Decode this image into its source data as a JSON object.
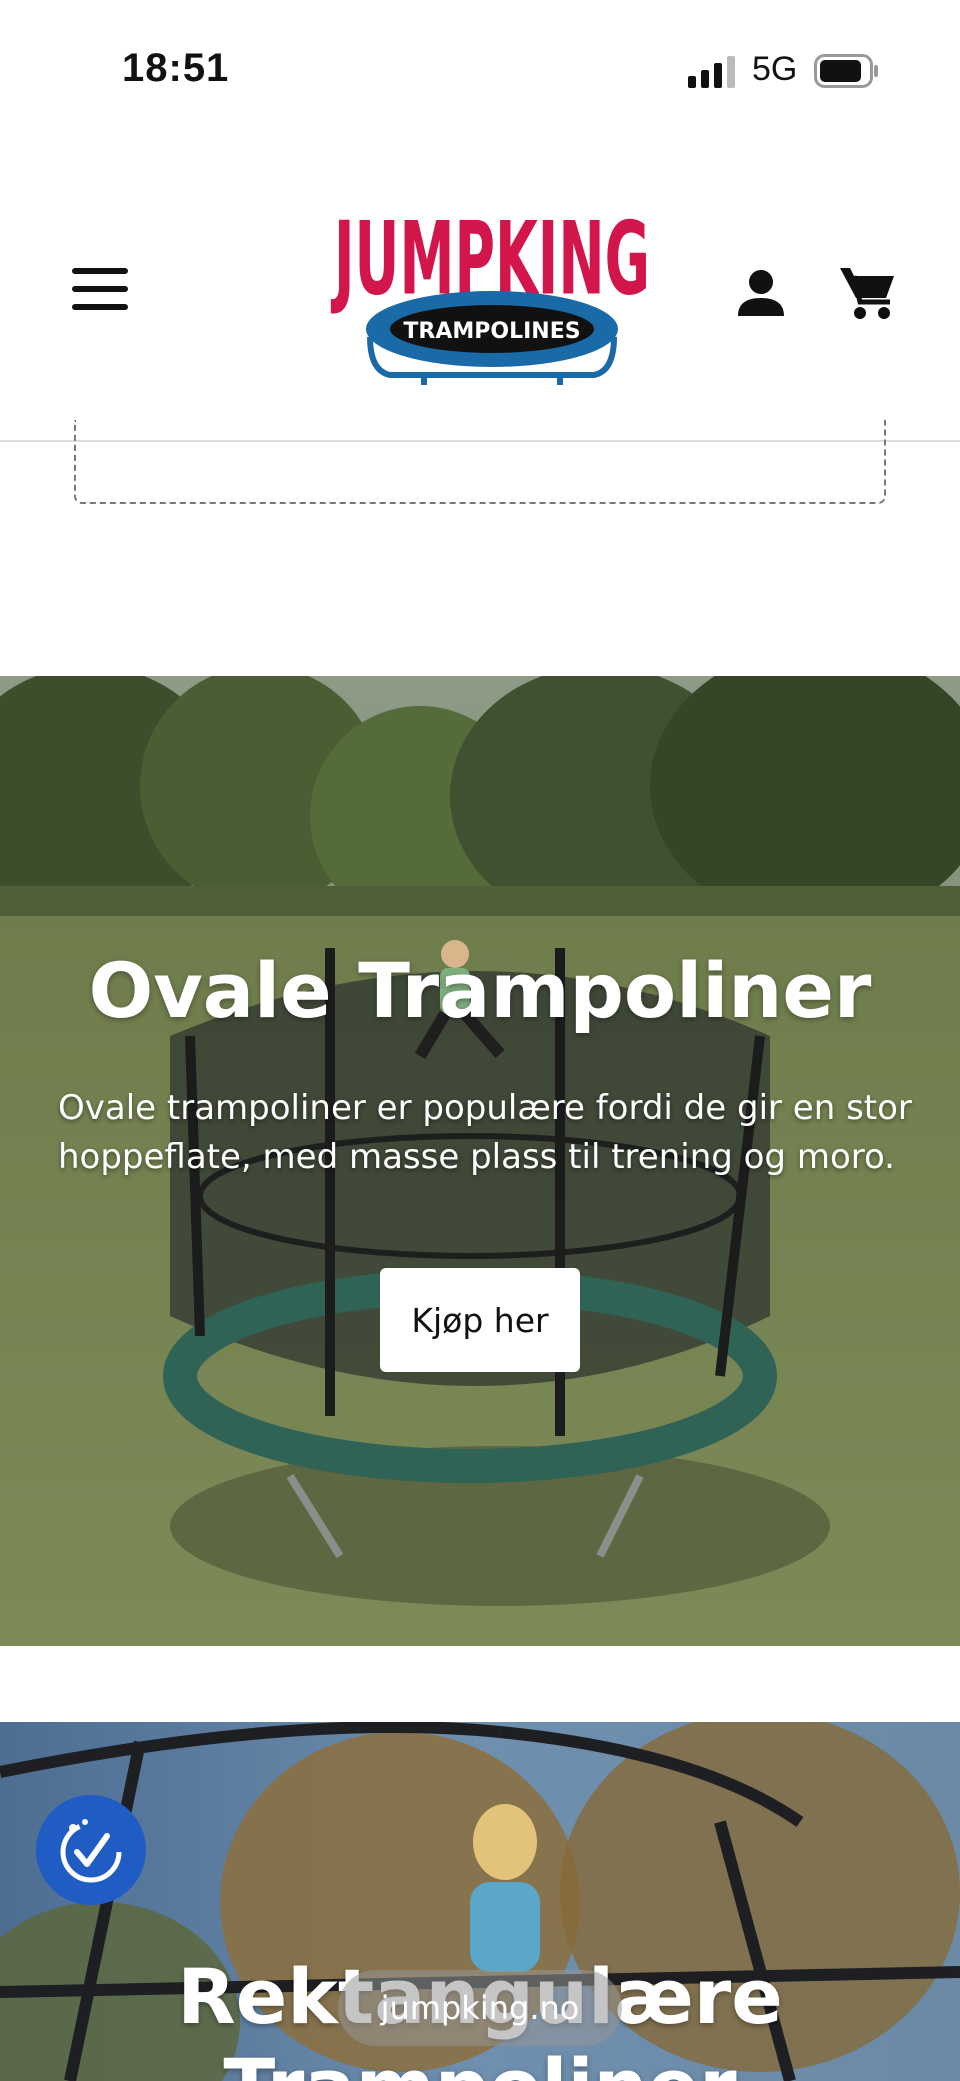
{
  "status_bar": {
    "time": "18:51",
    "network": "5G"
  },
  "header": {
    "logo": {
      "wordmark": "JUMPKING",
      "subtitle": "TRAMPOLINES"
    },
    "brand_color": "#d2164b",
    "secondary_color": "#1a6aa8"
  },
  "banners": [
    {
      "title": "Ovale Trampoliner",
      "description": "Ovale trampoliner er populære fordi de gir en stor hoppeflate, med masse plass til trening og moro.",
      "button_label": "Kjøp her"
    },
    {
      "title": "Rektangulære Trampoliner"
    }
  ],
  "browser": {
    "url": "jumpking.no"
  },
  "accessibility": {
    "color": "#1f5cc4"
  }
}
